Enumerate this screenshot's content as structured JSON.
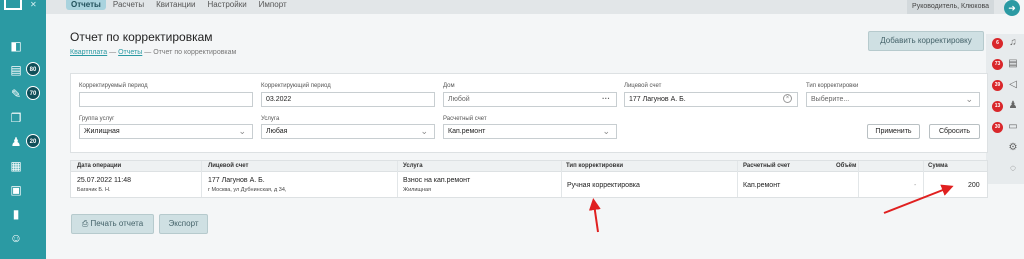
{
  "top_nav": {
    "items": [
      "Отчеты",
      "Расчеты",
      "Квитанции",
      "Настройки",
      "Импорт"
    ],
    "active_index": 0,
    "user": "Руководитель, Клюкова"
  },
  "left_sidebar": {
    "badges": [
      "80",
      "70",
      "20"
    ]
  },
  "right_sidebar": {
    "badges": [
      "6",
      "73",
      "39",
      "13",
      "30"
    ]
  },
  "page": {
    "title": "Отчет по корректировкам",
    "breadcrumb": [
      "Квартплата",
      "Отчеты",
      "Отчет по корректировкам"
    ],
    "breadcrumb_sep": "—",
    "add_button": "Добавить корректировку"
  },
  "filters": {
    "corrected_period": {
      "label": "Корректируемый период",
      "value": ""
    },
    "correcting_period": {
      "label": "Корректирующий период",
      "value": "03.2022"
    },
    "house": {
      "label": "Дом",
      "value": "Любой"
    },
    "account": {
      "label": "Лицевой счет",
      "value": "177 Лагунов А. Б."
    },
    "correction_type": {
      "label": "Тип корректировки",
      "placeholder": "Выберите..."
    },
    "service_group": {
      "label": "Группа услуг",
      "value": "Жилищная"
    },
    "service": {
      "label": "Услуга",
      "value": "Любая"
    },
    "settlement_account": {
      "label": "Расчетный счет",
      "value": "Кап.ремонт"
    },
    "apply_button": "Применить",
    "reset_button": "Сбросить"
  },
  "table": {
    "headers": [
      "Дата операции",
      "Лицевой счет",
      "Услуга",
      "Тип корректировки",
      "Расчетный счет",
      "Объём",
      "Сумма"
    ],
    "rows": [
      {
        "date": "25.07.2022 11:48",
        "operator": "Багачик Б. Н.",
        "account": "177 Лагунов А. Б.",
        "address": "г Москва, ул Дубнинская, д 34,",
        "service": "Взнос на кап.ремонт",
        "service_group": "Жилищная",
        "type": "Ручная корректировка",
        "settlement_account": "Кап.ремонт",
        "volume": "-",
        "amount": "200"
      }
    ]
  },
  "actions": {
    "print_button": "Печать отчета",
    "export_button": "Экспорт"
  },
  "colors": {
    "accent": "#2b9aa3",
    "badge_dark": "#0f4f59",
    "badge_red": "#d9272b",
    "arrow_red": "#e02020"
  },
  "icons": [
    "home-icon",
    "printer-icon",
    "gear-icon",
    "bell-icon",
    "chat-icon",
    "exit-icon"
  ]
}
